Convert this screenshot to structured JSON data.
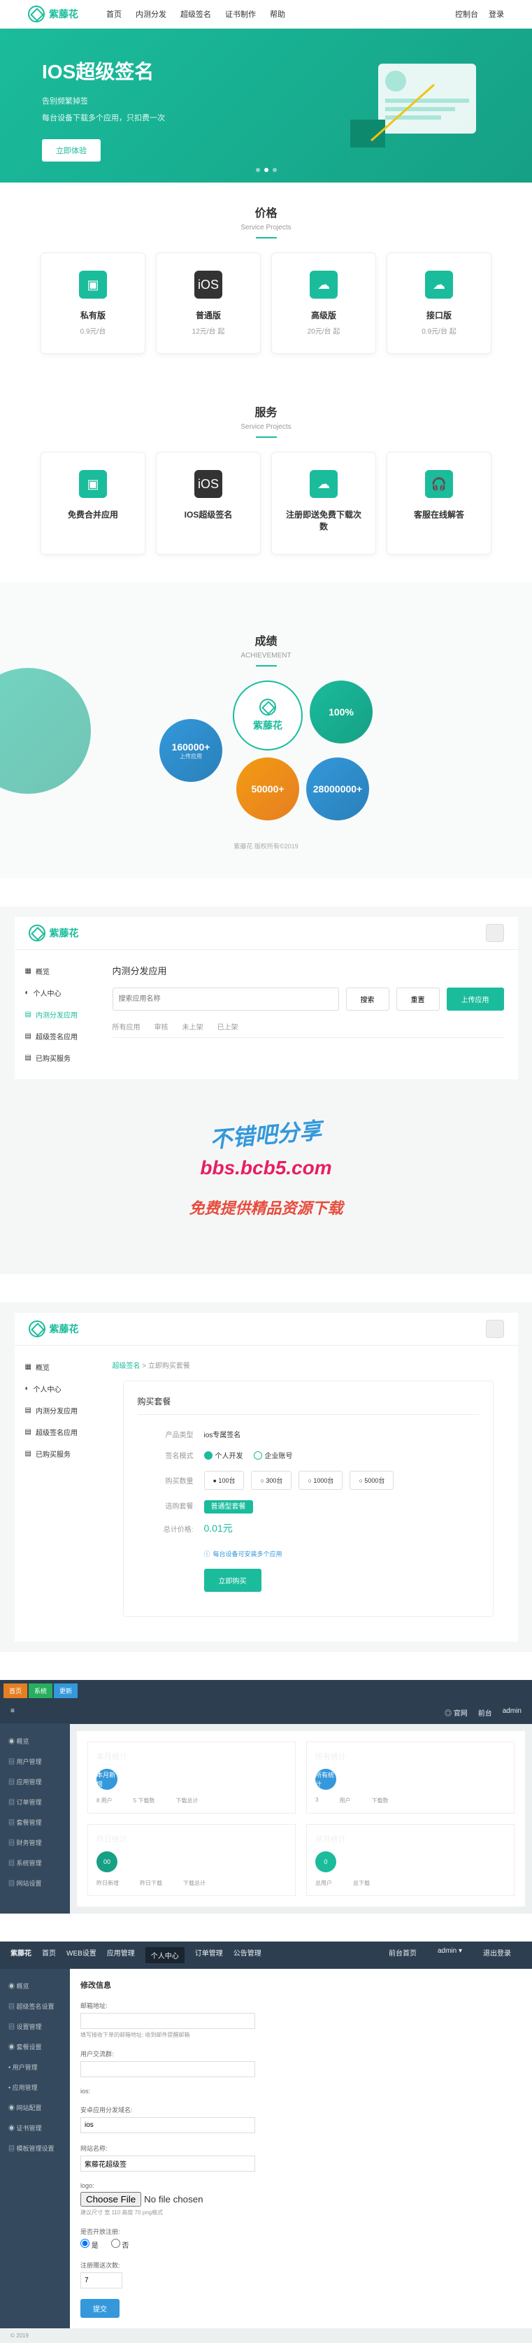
{
  "brand": "紫藤花",
  "topnav": {
    "links": [
      "首页",
      "内测分发",
      "超级签名",
      "证书制作",
      "帮助"
    ],
    "right": [
      "控制台",
      "登录"
    ]
  },
  "hero": {
    "title": "IOS超级签名",
    "sub1": "告别频繁掉签",
    "sub2": "每台设备下载多个应用，只扣费一次",
    "btn": "立即体验"
  },
  "pricing": {
    "header": "价格",
    "sub": "Service Projects",
    "cards": [
      {
        "title": "私有版",
        "price": "0.9元/台"
      },
      {
        "title": "普通版",
        "price": "12元/台 起"
      },
      {
        "title": "高级版",
        "price": "20元/台 起"
      },
      {
        "title": "接口版",
        "price": "0.9元/台 起"
      }
    ]
  },
  "services": {
    "header": "服务",
    "sub": "Service Projects",
    "cards": [
      {
        "title": "免费合并应用"
      },
      {
        "title": "IOS超级签名"
      },
      {
        "title": "注册即送免费下载次数"
      },
      {
        "title": "客服在线解答"
      }
    ]
  },
  "achievements": {
    "header": "成绩",
    "sub": "ACHIEVEMENT",
    "circles": [
      {
        "num": "160000+",
        "label": "上传应用"
      },
      {
        "num": "紫藤花",
        "label": ""
      },
      {
        "num": "100%",
        "label": ""
      },
      {
        "num": "50000+",
        "label": ""
      },
      {
        "num": "28000000+",
        "label": ""
      }
    ],
    "footer": "紫藤花 版权所有©2019"
  },
  "dashboard1": {
    "sidebar": [
      "概览",
      "个人中心",
      "内测分发应用",
      "超级签名应用",
      "已购买服务"
    ],
    "title": "内测分发应用",
    "search_placeholder": "搜索应用名称",
    "btn_search": "搜索",
    "btn_reset": "重置",
    "btn_upload": "上传应用",
    "tabs": [
      "所有应用",
      "审核",
      "未上架",
      "已上架"
    ]
  },
  "watermark": {
    "line1": "不错吧分享",
    "line2": "bbs.bcb5.com",
    "line3": "免费提供精品资源下载"
  },
  "dashboard2": {
    "breadcrumb_home": "超级签名",
    "breadcrumb_current": "立即购买套餐",
    "form_title": "购买套餐",
    "rows": {
      "product": {
        "label": "产品类型",
        "value": "ios专属签名"
      },
      "mode": {
        "label": "签名模式",
        "options": [
          "个人开发",
          "企业账号"
        ]
      },
      "count": {
        "label": "购买数量",
        "packages": [
          "● 100台",
          "○ 300台",
          "○ 1000台",
          "○ 5000台"
        ]
      },
      "package": {
        "label": "选购套餐",
        "option": "普通型套餐"
      },
      "price": {
        "label": "总计价格:",
        "value": "0.01元"
      },
      "helper": "每台设备可安装多个应用"
    },
    "btn_buy": "立即购买"
  },
  "admin": {
    "tabs": [
      "首页",
      "系统",
      "更新"
    ],
    "header_right": [
      "◎ 官网",
      "前台",
      "admin"
    ],
    "sidebar": [
      "◉ 概览",
      "▤ 用户管理",
      "▤ 应用管理",
      "▤ 订单管理",
      "▤ 套餐管理",
      "▤ 财务管理",
      "▤ 系统管理",
      "▤ 网站设置"
    ],
    "stats": [
      {
        "title": "本月统计",
        "circle": "本月新增",
        "subs": [
          "8 用户",
          "5 下载数",
          "下载总计"
        ]
      },
      {
        "title": "所有统计",
        "circle": "所有统计",
        "subs": [
          "3",
          "用户",
          "下载数"
        ]
      },
      {
        "title": "昨日统计",
        "circle": "00",
        "subs": [
          "昨日新增",
          "昨日下载",
          "下载总计"
        ]
      },
      {
        "title": "总共统计",
        "circle": "0",
        "subs": [
          "总用户",
          "总下载"
        ]
      }
    ]
  },
  "admin2": {
    "brand": "紫藤花",
    "nav": [
      "首页",
      "WEB设置",
      "应用管理",
      "个人中心",
      "订单管理",
      "公告管理"
    ],
    "nav_right": [
      "前台首页",
      "admin ▾",
      "退出登录"
    ],
    "sidebar": [
      "◉ 概览",
      "▤ 超级签名设置",
      "▤ 设置管理",
      "◉ 套餐设置",
      "• 用户管理",
      "• 应用管理",
      "◉ 网站配置",
      "◉ 证书管理",
      "▤ 模板管理设置"
    ],
    "form": {
      "title": "修改信息",
      "fields": [
        {
          "label": "邮箱地址:",
          "value": "",
          "helper": "填写接收下单的邮箱地址: 收到邮件提醒邮箱"
        },
        {
          "label": "用户交流群:",
          "value": "",
          "helper": ""
        },
        {
          "label": "ios:",
          "value": "",
          "helper": ""
        },
        {
          "label": "安卓应用分发域名:",
          "value": "ios",
          "helper": ""
        },
        {
          "label": "网站名称:",
          "value": "紫藤花超级签",
          "helper": ""
        },
        {
          "label": "logo:",
          "value": "",
          "helper": "建议尺寸 宽 110 高度 70 png格式",
          "has_file": true
        },
        {
          "label": "是否开放注册:",
          "value": "",
          "radios": [
            "是",
            "否"
          ]
        },
        {
          "label": "注册赠送次数:",
          "value": "7",
          "helper": ""
        }
      ],
      "submit": "提交"
    },
    "footer": "© 2019"
  }
}
